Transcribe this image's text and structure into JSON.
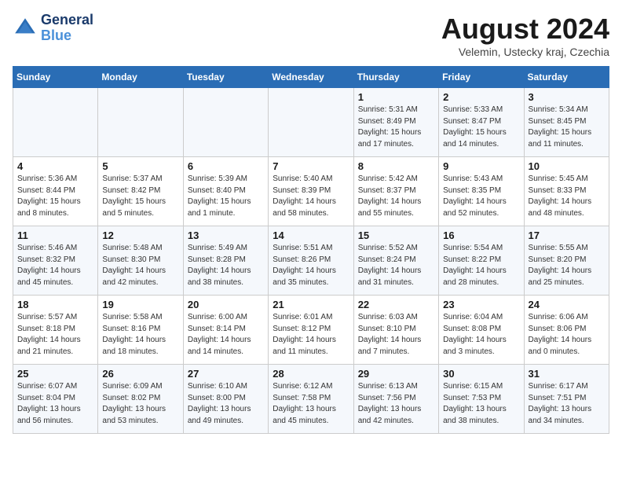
{
  "header": {
    "logo_line1": "General",
    "logo_line2": "Blue",
    "month_year": "August 2024",
    "location": "Velemin, Ustecky kraj, Czechia"
  },
  "weekdays": [
    "Sunday",
    "Monday",
    "Tuesday",
    "Wednesday",
    "Thursday",
    "Friday",
    "Saturday"
  ],
  "weeks": [
    [
      {
        "day": "",
        "info": ""
      },
      {
        "day": "",
        "info": ""
      },
      {
        "day": "",
        "info": ""
      },
      {
        "day": "",
        "info": ""
      },
      {
        "day": "1",
        "info": "Sunrise: 5:31 AM\nSunset: 8:49 PM\nDaylight: 15 hours\nand 17 minutes."
      },
      {
        "day": "2",
        "info": "Sunrise: 5:33 AM\nSunset: 8:47 PM\nDaylight: 15 hours\nand 14 minutes."
      },
      {
        "day": "3",
        "info": "Sunrise: 5:34 AM\nSunset: 8:45 PM\nDaylight: 15 hours\nand 11 minutes."
      }
    ],
    [
      {
        "day": "4",
        "info": "Sunrise: 5:36 AM\nSunset: 8:44 PM\nDaylight: 15 hours\nand 8 minutes."
      },
      {
        "day": "5",
        "info": "Sunrise: 5:37 AM\nSunset: 8:42 PM\nDaylight: 15 hours\nand 5 minutes."
      },
      {
        "day": "6",
        "info": "Sunrise: 5:39 AM\nSunset: 8:40 PM\nDaylight: 15 hours\nand 1 minute."
      },
      {
        "day": "7",
        "info": "Sunrise: 5:40 AM\nSunset: 8:39 PM\nDaylight: 14 hours\nand 58 minutes."
      },
      {
        "day": "8",
        "info": "Sunrise: 5:42 AM\nSunset: 8:37 PM\nDaylight: 14 hours\nand 55 minutes."
      },
      {
        "day": "9",
        "info": "Sunrise: 5:43 AM\nSunset: 8:35 PM\nDaylight: 14 hours\nand 52 minutes."
      },
      {
        "day": "10",
        "info": "Sunrise: 5:45 AM\nSunset: 8:33 PM\nDaylight: 14 hours\nand 48 minutes."
      }
    ],
    [
      {
        "day": "11",
        "info": "Sunrise: 5:46 AM\nSunset: 8:32 PM\nDaylight: 14 hours\nand 45 minutes."
      },
      {
        "day": "12",
        "info": "Sunrise: 5:48 AM\nSunset: 8:30 PM\nDaylight: 14 hours\nand 42 minutes."
      },
      {
        "day": "13",
        "info": "Sunrise: 5:49 AM\nSunset: 8:28 PM\nDaylight: 14 hours\nand 38 minutes."
      },
      {
        "day": "14",
        "info": "Sunrise: 5:51 AM\nSunset: 8:26 PM\nDaylight: 14 hours\nand 35 minutes."
      },
      {
        "day": "15",
        "info": "Sunrise: 5:52 AM\nSunset: 8:24 PM\nDaylight: 14 hours\nand 31 minutes."
      },
      {
        "day": "16",
        "info": "Sunrise: 5:54 AM\nSunset: 8:22 PM\nDaylight: 14 hours\nand 28 minutes."
      },
      {
        "day": "17",
        "info": "Sunrise: 5:55 AM\nSunset: 8:20 PM\nDaylight: 14 hours\nand 25 minutes."
      }
    ],
    [
      {
        "day": "18",
        "info": "Sunrise: 5:57 AM\nSunset: 8:18 PM\nDaylight: 14 hours\nand 21 minutes."
      },
      {
        "day": "19",
        "info": "Sunrise: 5:58 AM\nSunset: 8:16 PM\nDaylight: 14 hours\nand 18 minutes."
      },
      {
        "day": "20",
        "info": "Sunrise: 6:00 AM\nSunset: 8:14 PM\nDaylight: 14 hours\nand 14 minutes."
      },
      {
        "day": "21",
        "info": "Sunrise: 6:01 AM\nSunset: 8:12 PM\nDaylight: 14 hours\nand 11 minutes."
      },
      {
        "day": "22",
        "info": "Sunrise: 6:03 AM\nSunset: 8:10 PM\nDaylight: 14 hours\nand 7 minutes."
      },
      {
        "day": "23",
        "info": "Sunrise: 6:04 AM\nSunset: 8:08 PM\nDaylight: 14 hours\nand 3 minutes."
      },
      {
        "day": "24",
        "info": "Sunrise: 6:06 AM\nSunset: 8:06 PM\nDaylight: 14 hours\nand 0 minutes."
      }
    ],
    [
      {
        "day": "25",
        "info": "Sunrise: 6:07 AM\nSunset: 8:04 PM\nDaylight: 13 hours\nand 56 minutes."
      },
      {
        "day": "26",
        "info": "Sunrise: 6:09 AM\nSunset: 8:02 PM\nDaylight: 13 hours\nand 53 minutes."
      },
      {
        "day": "27",
        "info": "Sunrise: 6:10 AM\nSunset: 8:00 PM\nDaylight: 13 hours\nand 49 minutes."
      },
      {
        "day": "28",
        "info": "Sunrise: 6:12 AM\nSunset: 7:58 PM\nDaylight: 13 hours\nand 45 minutes."
      },
      {
        "day": "29",
        "info": "Sunrise: 6:13 AM\nSunset: 7:56 PM\nDaylight: 13 hours\nand 42 minutes."
      },
      {
        "day": "30",
        "info": "Sunrise: 6:15 AM\nSunset: 7:53 PM\nDaylight: 13 hours\nand 38 minutes."
      },
      {
        "day": "31",
        "info": "Sunrise: 6:17 AM\nSunset: 7:51 PM\nDaylight: 13 hours\nand 34 minutes."
      }
    ]
  ]
}
